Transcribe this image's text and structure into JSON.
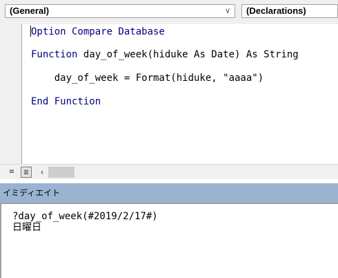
{
  "toolbar": {
    "object_dropdown": "(General)",
    "procedure_dropdown": "(Declarations)"
  },
  "code_lines": [
    {
      "kw": "Option Compare Database",
      "rest": ""
    },
    {
      "kw": "Function",
      "rest": " day_of_week(hiduke As Date) As String"
    },
    {
      "kw": "",
      "rest": "    day_of_week = Format(hiduke, \"aaaa\")"
    },
    {
      "kw": "End Function",
      "rest": ""
    }
  ],
  "immediate": {
    "title": "イミディエイト",
    "lines": [
      "?day_of_week(#2019/2/17#)",
      "日曜日"
    ]
  },
  "colors": {
    "keyword": "#000080",
    "title_bar": "#99b4d1"
  }
}
